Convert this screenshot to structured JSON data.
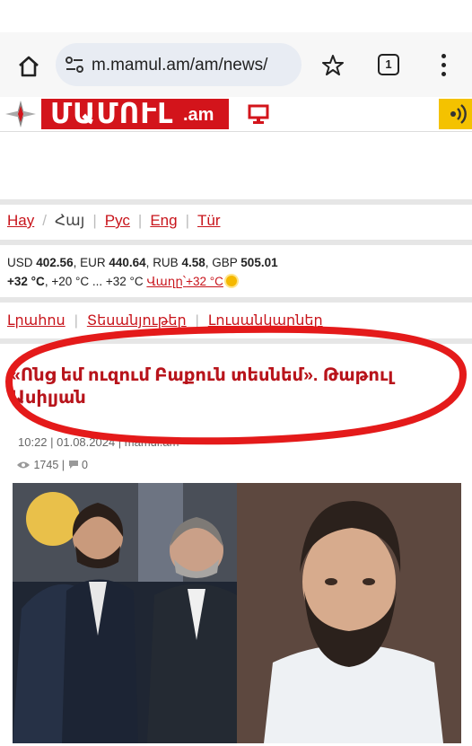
{
  "browser": {
    "url": "m.mamul.am/am/news/",
    "tab_count": "1"
  },
  "site": {
    "logo_main": "ՄԱՄՈՒԼ",
    "logo_domain": ".am",
    "brand_color": "#d3141b"
  },
  "languages": {
    "items": [
      "Hay",
      "Հայ",
      "Рус",
      "Eng",
      "Tür"
    ],
    "current": "Հայ"
  },
  "rates": {
    "usd_label": "USD",
    "usd": "402.56",
    "eur_label": "EUR",
    "eur": "440.64",
    "rub_label": "RUB",
    "rub": "4.58",
    "gbp_label": "GBP",
    "gbp": "505.01",
    "weather_now": "+32 °C",
    "weather_range": ", +20 °C ... +32 °C",
    "tomorrow_label": "Վաղը՝",
    "tomorrow_temp": "+32 °C"
  },
  "nav": {
    "items": [
      "Լրահոս",
      "Տեսանյութեր",
      "Լուսանկարներ"
    ]
  },
  "article": {
    "title": "«Ոնց եմ ուզում Բաքուն տեսնեմ». Թաթուլ Ասիլյան",
    "meta": "10:22 | 01.08.2024 | mamul.am",
    "views": "1745 |",
    "comments": "0"
  },
  "icons": [
    "home-icon",
    "site-settings-icon",
    "star-icon",
    "tabs-icon",
    "menu-icon",
    "compass-logo-icon",
    "tv-icon",
    "broadcast-icon",
    "eye-icon",
    "comment-icon",
    "sun-icon"
  ]
}
